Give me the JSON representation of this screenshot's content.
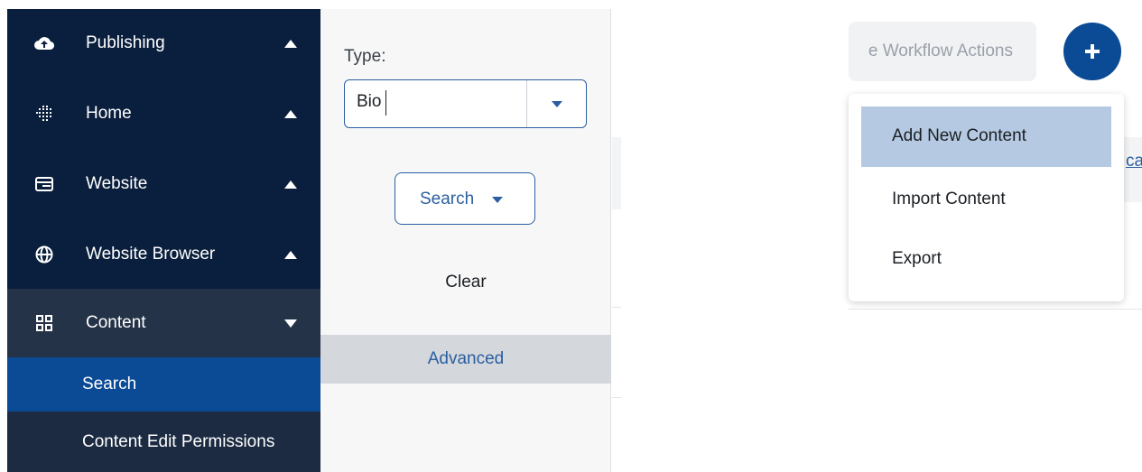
{
  "sidebar": {
    "items": [
      {
        "label": "Publishing",
        "icon": "cloud-upload-icon",
        "caret": "up"
      },
      {
        "label": "Home",
        "icon": "dotted-globe-icon",
        "caret": "up"
      },
      {
        "label": "Website",
        "icon": "browser-window-icon",
        "caret": "up"
      },
      {
        "label": "Website Browser",
        "icon": "globe-icon",
        "caret": "up"
      },
      {
        "label": "Content",
        "icon": "grid-icon",
        "caret": "down"
      }
    ],
    "subitems": [
      {
        "label": "Search",
        "active": true
      },
      {
        "label": "Content Edit Permissions",
        "active": false
      }
    ]
  },
  "filter": {
    "type_label": "Type:",
    "type_value": "Bio",
    "search_label": "Search",
    "clear_label": "Clear",
    "advanced_label": "Advanced"
  },
  "toolbar": {
    "workflow_label": "e Workflow Actions",
    "plus_icon": "plus-icon"
  },
  "add_menu": {
    "items": [
      "Add New Content",
      "Import Content",
      "Export"
    ],
    "highlighted": "Add New Content"
  },
  "edge_link_text": "cat",
  "colors": {
    "sidebar_bg": "#0a1f3d",
    "accent": "#0b4a94",
    "highlight": "#b5c9e2"
  }
}
